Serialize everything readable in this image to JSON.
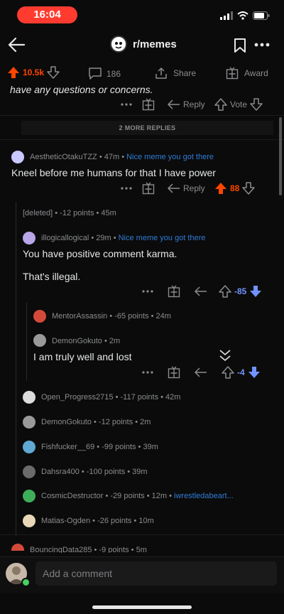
{
  "status": {
    "time": "16:04"
  },
  "header": {
    "subreddit": "r/memes"
  },
  "post_actions": {
    "score": "10.5k",
    "comments": "186",
    "share": "Share",
    "award": "Award"
  },
  "top_comment": {
    "text_tail": "have any questions or concerns.",
    "reply": "Reply",
    "vote": "Vote"
  },
  "more_replies": "2 MORE REPLIES",
  "c1": {
    "author": "AestheticOtakuTZZ",
    "age": "• 47m •",
    "flair": "Nice meme you got there",
    "body": "Kneel before me humans for that I have power",
    "reply": "Reply",
    "score": "88"
  },
  "c2": {
    "meta": "[deleted] • -12 points • 45m"
  },
  "c3": {
    "author": "illogicallogical",
    "age": "• 29m •",
    "flair": "Nice meme you got there",
    "body1": "You have positive comment karma.",
    "body2": "That's illegal.",
    "score": "-85"
  },
  "c4": {
    "meta": "MentorAssassin • -65 points • 24m"
  },
  "c5": {
    "meta": "DemonGokuto • 2m",
    "body": "I am truly well and lost",
    "score": "-4"
  },
  "collapsed": [
    {
      "author": "Open_Progress2715",
      "meta": "• -117 points • 42m"
    },
    {
      "author": "DemonGokuto",
      "meta": "• -12 points • 2m"
    },
    {
      "author": "Fishfucker__69",
      "meta": "• -99 points • 39m"
    },
    {
      "author": "Dahsra400",
      "meta": "• -100 points • 39m"
    },
    {
      "author": "CosmicDestructor",
      "meta": "• -29 points • 12m •",
      "flair": "iwrestledabeart..."
    },
    {
      "author": "Matias-Ogden",
      "meta": "• -26 points • 10m"
    }
  ],
  "bottom_peek": {
    "meta": "BouncingData285 • -9 points • 5m"
  },
  "composer": {
    "placeholder": "Add a comment"
  },
  "colors": {
    "orange": "#ff4500",
    "blue": "#7193ff",
    "flair": "#2f7cd6",
    "status_red": "#ff3b30"
  }
}
